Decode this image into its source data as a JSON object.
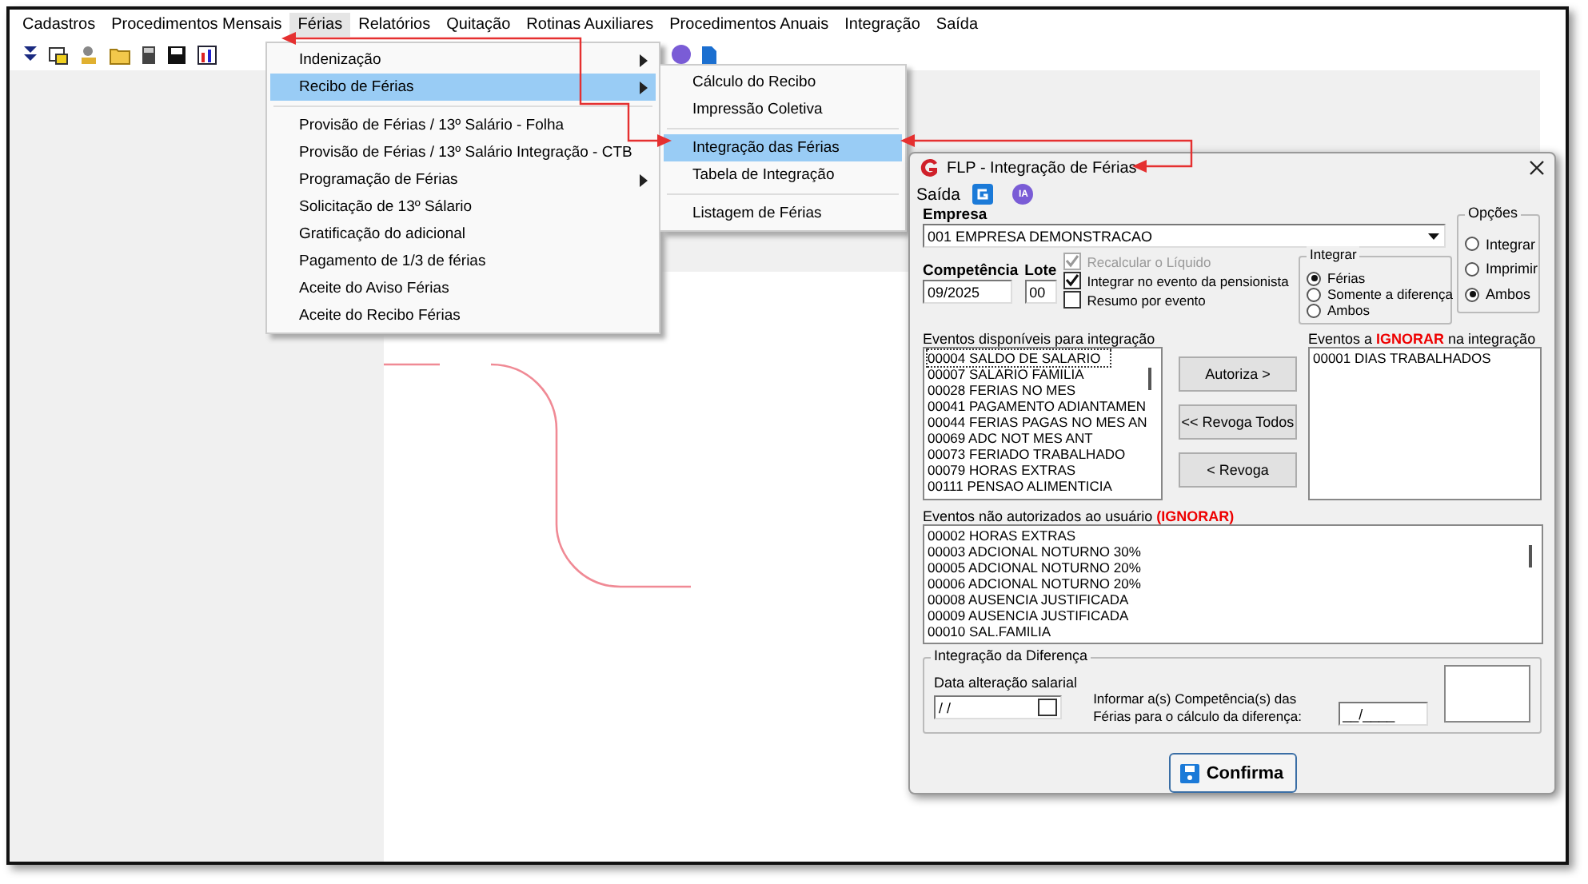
{
  "menu_bar": [
    {
      "label": "Cadastros",
      "selected": false
    },
    {
      "label": "Procedimentos Mensais",
      "selected": false
    },
    {
      "label": "Férias",
      "selected": true
    },
    {
      "label": "Relatórios",
      "selected": false
    },
    {
      "label": "Quitação",
      "selected": false
    },
    {
      "label": "Rotinas Auxiliares",
      "selected": false
    },
    {
      "label": "Procedimentos Anuais",
      "selected": false
    },
    {
      "label": "Integração",
      "selected": false
    },
    {
      "label": "Saída",
      "selected": false
    }
  ],
  "ferias_menu": {
    "groups": [
      [
        {
          "label": "Indenização",
          "submenu": true,
          "selected": false
        },
        {
          "label": "Recibo de Férias",
          "submenu": true,
          "selected": true
        }
      ],
      [
        {
          "label": "Provisão de Férias / 13º Salário - Folha",
          "submenu": false,
          "selected": false
        },
        {
          "label": "Provisão de Férias / 13º Salário Integração - CTB",
          "submenu": false,
          "selected": false
        },
        {
          "label": "Programação de Férias",
          "submenu": true,
          "selected": false
        },
        {
          "label": "Solicitação de 13º Sálario",
          "submenu": false,
          "selected": false
        },
        {
          "label": "Gratificação do adicional",
          "submenu": false,
          "selected": false
        },
        {
          "label": "Pagamento de 1/3 de férias",
          "submenu": false,
          "selected": false
        },
        {
          "label": "Aceite do Aviso Férias",
          "submenu": false,
          "selected": false
        },
        {
          "label": "Aceite do Recibo Férias",
          "submenu": false,
          "selected": false
        }
      ]
    ]
  },
  "recibo_submenu": {
    "groups": [
      [
        {
          "label": "Cálculo do Recibo",
          "selected": false
        },
        {
          "label": "Impressão Coletiva",
          "selected": false
        }
      ],
      [
        {
          "label": "Integração das Férias",
          "selected": true
        },
        {
          "label": "Tabela de Integração",
          "selected": false
        }
      ],
      [
        {
          "label": "Listagem de Férias",
          "selected": false
        }
      ]
    ]
  },
  "dialog": {
    "title": "FLP - Integração de Férias",
    "menu": "Saída",
    "ia_badge": "IA",
    "empresa": {
      "label": "Empresa",
      "value": "001 EMPRESA DEMONSTRACAO"
    },
    "competencia": {
      "label": "Competência",
      "value": "09/2025"
    },
    "lote": {
      "label": "Lote",
      "value": "00"
    },
    "checkboxes": [
      {
        "label": "Recalcular o Líquido",
        "checked": true,
        "disabled": true
      },
      {
        "label": "Integrar no evento da pensionista",
        "checked": true,
        "disabled": false
      },
      {
        "label": "Resumo por evento",
        "checked": false,
        "disabled": false
      }
    ],
    "integrar": {
      "title": "Integrar",
      "options": [
        {
          "label": "Férias",
          "selected": true
        },
        {
          "label": "Somente a diferença",
          "selected": false
        },
        {
          "label": "Ambos",
          "selected": false
        }
      ]
    },
    "opcoes": {
      "title": "Opções",
      "options": [
        {
          "label": "Integrar",
          "selected": false
        },
        {
          "label": "Imprimir",
          "selected": false
        },
        {
          "label": "Ambos",
          "selected": true
        }
      ]
    },
    "available": {
      "label": "Eventos disponíveis para integração",
      "items": [
        {
          "text": "00004 SALDO DE SALARIO",
          "selected": true
        },
        {
          "text": "00007 SALARIO FAMILIA",
          "selected": false
        },
        {
          "text": "00028 FERIAS NO MES",
          "selected": false
        },
        {
          "text": "00041 PAGAMENTO ADIANTAMEN",
          "selected": false
        },
        {
          "text": "00044 FERIAS PAGAS NO MES AN",
          "selected": false
        },
        {
          "text": "00069 ADC NOT MES ANT",
          "selected": false
        },
        {
          "text": "00073 FERIADO TRABALHADO",
          "selected": false
        },
        {
          "text": "00079 HORAS EXTRAS",
          "selected": false
        },
        {
          "text": "00111 PENSAO ALIMENTICIA",
          "selected": false
        }
      ]
    },
    "buttons": [
      "Autoriza >",
      "<< Revoga Todos",
      "< Revoga"
    ],
    "ignored": {
      "label": "Eventos a **IGNORAR** na integração",
      "items": [
        "00001 DIAS TRABALHADOS"
      ]
    },
    "not_authorized": {
      "label": "Eventos não autorizados ao usuário **(IGNORAR)**",
      "items": [
        "00002 HORAS EXTRAS",
        "00003 ADCIONAL NOTURNO 30%",
        "00005 ADCIONAL NOTURNO 20%",
        "00006 ADCIONAL NOTURNO 20%",
        "00008 AUSENCIA JUSTIFICADA",
        "00009 AUSENCIA JUSTIFICADA",
        "00010 SAL.FAMILIA"
      ]
    },
    "diferenca": {
      "title": "Integração da Diferença",
      "date_label": "Data alteração salarial",
      "date_value": " / /",
      "comp_label": "Informar a(s) Competência(s) das Férias para o cálculo da diferença:",
      "comp_value": "__/____"
    },
    "confirm": "Confirma"
  }
}
